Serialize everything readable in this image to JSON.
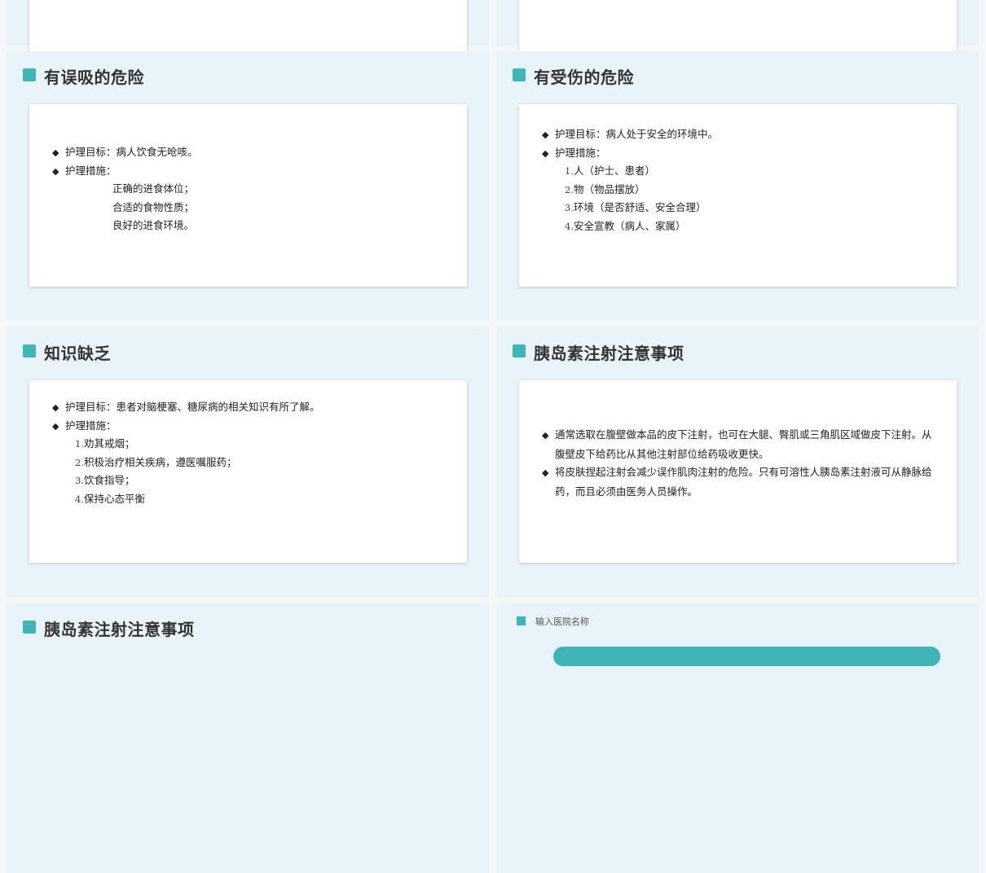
{
  "slides": {
    "aspiration": {
      "title": "有误吸的危险",
      "goal": "护理目标：病人饮食无呛咳。",
      "measures_label": "护理措施：",
      "items": [
        "正确的进食体位；",
        "合适的食物性质；",
        "良好的进食环境。"
      ]
    },
    "injury": {
      "title": "有受伤的危险",
      "goal": "护理目标：病人处于安全的环境中。",
      "measures_label": "护理措施：",
      "items": [
        {
          "num": "1.",
          "text": "人（护士、患者）"
        },
        {
          "num": "2.",
          "text": "物（物品摆放）"
        },
        {
          "num": "3.",
          "text": "环境（是否舒适、安全合理）"
        },
        {
          "num": "4.",
          "text": "安全宣教（病人、家属）"
        }
      ]
    },
    "knowledge": {
      "title": "知识缺乏",
      "goal": "护理目标：患者对脑梗塞、糖尿病的相关知识有所了解。",
      "measures_label": "护理措施：",
      "items": [
        {
          "num": "1.",
          "text": "劝其戒烟；"
        },
        {
          "num": "2.",
          "text": "积极治疗相关疾病，遵医嘱服药；"
        },
        {
          "num": "3.",
          "text": "饮食指导；"
        },
        {
          "num": "4.",
          "text": "保持心态平衡"
        }
      ]
    },
    "insulin": {
      "title": "胰岛素注射注意事项",
      "points": [
        "通常选取在腹壁做本品的皮下注射，也可在大腿、臀肌或三角肌区域做皮下注射。从腹壁皮下给药比从其他注射部位给药吸收更快。",
        "将皮肤捏起注射会减少误作肌肉注射的危险。只有可溶性人胰岛素注射液可从静脉给药，而且必须由医务人员操作。"
      ]
    },
    "insulin2": {
      "title": "胰岛素注射注意事项"
    },
    "footer": {
      "hospital": "输入医院名称"
    }
  },
  "bullet_glyph": "◆",
  "colors": {
    "accent": "#3fb5b7",
    "slide_bg": "#e8f4f9"
  }
}
